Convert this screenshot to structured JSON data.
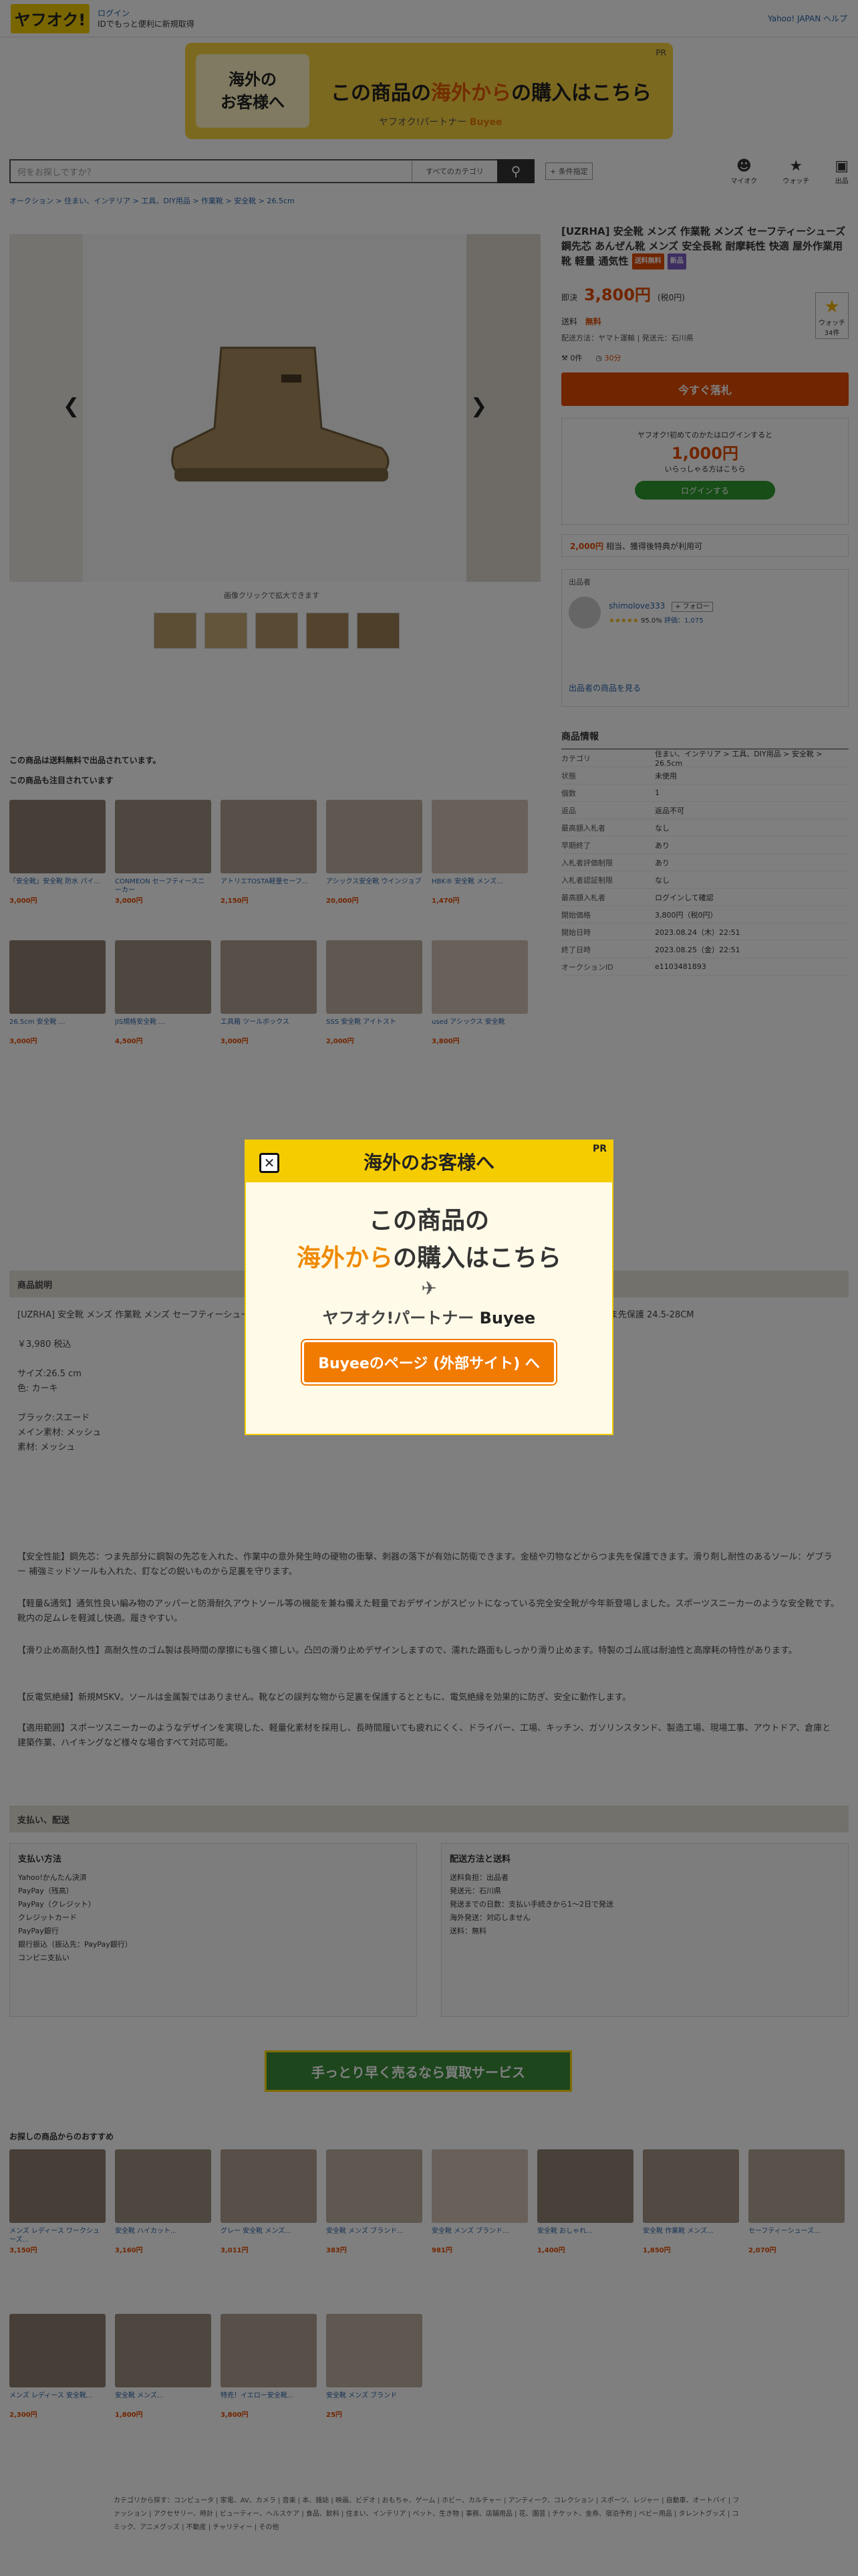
{
  "header": {
    "logo_text": "ヤフオク!",
    "login_label": "ログイン",
    "login_sub": "IDでもっと便利に新規取得",
    "right_link": "Yahoo! JAPAN ヘルプ"
  },
  "top_banner": {
    "left_text": "海外の\nお客様へ",
    "main_pre": "この商品の",
    "main_hl": "海外から",
    "main_post": "の購入はこちら",
    "sub_text": "ヤフオク!パートナー",
    "sub_buyee": "Buyee",
    "pr": "PR"
  },
  "search": {
    "placeholder": "何をお探しですか？",
    "category": "すべてのカテゴリ",
    "button_icon": "search-icon",
    "advanced": "+ 条件指定"
  },
  "head_icons": [
    {
      "icon": "person-icon",
      "label": "マイオク"
    },
    {
      "icon": "star-icon",
      "label": "ウォッチ"
    },
    {
      "icon": "bag-icon",
      "label": "出品"
    }
  ],
  "breadcrumb": "オークション > 住まい、インテリア > 工具、DIY用品 > 作業靴 > 安全靴 > 26.5cm",
  "gallery": {
    "caption": "画像クリックで拡大できます"
  },
  "item": {
    "title": "[UZRHA] 安全靴 メンズ 作業靴 メンズ セーフティーシューズ 鋼先芯 あんぜん靴 メンズ 安全長靴 耐摩耗性 快適 屋外作業用靴 軽量 通気性",
    "badge1": "送料無料",
    "badge2": "新品",
    "price_label": "即決",
    "price": "3,800円",
    "price_tax": "(税0円)",
    "shipping_label": "送料",
    "shipping_value": "無料",
    "ship_detail": "配送方法：ヤマト運輸 | 発送元：石川県",
    "bids": "0件",
    "time_left": "30分",
    "watch_label": "ウォッチ",
    "watch_count": "34件",
    "bid_button": "今すぐ落札"
  },
  "promo": {
    "text1": "ヤフオク!初めてのかたはログインすると",
    "big": "1,000円",
    "text2": "いらっしゃる方はこちら",
    "login_button": "ログインする"
  },
  "points": {
    "value": "2,000円",
    "text": "相当、獲得後特典が利用可"
  },
  "seller": {
    "label": "出品者",
    "name": "shimolove333",
    "follow": "+ フォロー",
    "rating": "95.0%",
    "rating_count": "評価：1,075",
    "more": "出品者の商品を見る"
  },
  "info": {
    "heading": "商品情報",
    "rows": [
      {
        "k": "カテゴリ",
        "v": "住まい、インテリア > 工具、DIY用品 > 安全靴 > 26.5cm"
      },
      {
        "k": "状態",
        "v": "未使用"
      },
      {
        "k": "個数",
        "v": "1"
      },
      {
        "k": "返品",
        "v": "返品不可"
      },
      {
        "k": "最高額入札者",
        "v": "なし"
      },
      {
        "k": "早期終了",
        "v": "あり"
      },
      {
        "k": "入札者評価制限",
        "v": "あり"
      },
      {
        "k": "入札者認証制限",
        "v": "なし"
      },
      {
        "k": "最高額入札者",
        "v": "ログインして確認"
      },
      {
        "k": "開始価格",
        "v": "3,800円（税0円）"
      },
      {
        "k": "開始日時",
        "v": "2023.08.24（木）22:51"
      },
      {
        "k": "終了日時",
        "v": "2023.08.25（金）22:51"
      },
      {
        "k": "オークションID",
        "v": "e1103481893"
      }
    ]
  },
  "shipping_note": "この商品は送料無料で出品されています。",
  "rec1": {
    "title": "この商品も注目されています",
    "items": [
      {
        "name": "「安全靴」安全靴 防水 パイ...",
        "price": "3,000円"
      },
      {
        "name": "CONMEON セーフティースニーカー",
        "price": "3,000円"
      },
      {
        "name": "アトリエTOSTA軽量セーフ...",
        "price": "2,150円"
      },
      {
        "name": "アシックス安全靴 ウインジョブ",
        "price": "20,000円"
      },
      {
        "name": "HBK® 安全靴 メンズ...",
        "price": "1,470円"
      }
    ]
  },
  "rec2": {
    "items": [
      {
        "name": "26.5cm 安全靴 ...",
        "price": "3,000円"
      },
      {
        "name": "JIS規格安全靴 ...",
        "price": "4,500円"
      },
      {
        "name": "工具箱 ツールボックス",
        "price": "3,000円"
      },
      {
        "name": "SSS 安全靴 アイトスト",
        "price": "2,000円"
      },
      {
        "name": "used アシックス 安全靴",
        "price": "3,800円"
      }
    ]
  },
  "desc": {
    "heading": "商品説明",
    "lines": [
      "[UZRHA] 安全靴 メンズ 作業靴 メンズ セーフティーシューズ 鋼先芯 あんぜん靴 メンズ 安全長靴 耐摩耗性 快適 屋外作業用靴 軽量 通気性 滑り止め つま先保護 24.5-28CM",
      "",
      "￥3,980 税込",
      "",
      "サイズ:26.5 cm",
      "色: カーキ",
      "",
      "ブラック:スエード",
      "メイン素材: メッシュ",
      "素材: メッシュ"
    ],
    "para1": "【安全性能】鋼先芯：つま先部分に鋼製の先芯を入れた、作業中の意外発生時の硬物の衝撃、刺器の落下が有効に防衛できます。金槌や刃物などからつま先を保護できます。滑り剤し耐性のあるソール：ゲブラー 補強ミッドソールも入れた、釘などの鋭いものから足裏を守ります。",
    "para2": "【軽量&通気】通気性良い編み物のアッパーと防滑耐久アウトソール等の機能を兼ね備えた軽量でおデザインがスピットになっている完全安全靴が今年新登場しました。スポーツスニーカーのような安全靴です。靴内の足ムレを軽減し快適。履きやすい。",
    "para3": "【滑り止め高耐久性】高耐久性のゴム製は長時間の摩擦にも強く擦しい。凸凹の滑り止めデザインしますので、濡れた路面もしっかり滑り止めます。特製のゴム底は耐油性と高摩耗の特性があります。",
    "para4": "【反電気絶縁】新規MSKV。ソールは金属製ではありません。靴などの誤判な物から足裏を保護するとともに、電気絶縁を効果的に防ぎ、安全に動作します。",
    "para5": "【適用範囲】スポーツスニーカーのようなデザインを実現した、軽量化素材を採用し、長時間履いても疲れにくく、ドライバー、工場、キッチン、ガソリンスタンド、製造工場、現場工事、アウトドア、倉庫と建築作業、ハイキングなど様々な場合すべて対応可能。"
  },
  "payship": {
    "heading": "支払い、配送",
    "pay_title": "支払い方法",
    "pay_items": [
      "Yahoo!かんたん決済",
      "PayPay（残高）",
      "PayPay（クレジット）",
      "クレジットカード",
      "PayPay銀行",
      "銀行振込（振込先：PayPay銀行）",
      "コンビニ支払い"
    ],
    "ship_title": "配送方法と送料",
    "ship_items": [
      "送料負担：出品者",
      "発送元：石川県",
      "発送までの日数：支払い手続きから1〜2日で発送",
      "海外発送：対応しません",
      "送料：無料"
    ]
  },
  "buy_banner": "手っとり早く売るなら買取サービス",
  "rec3": {
    "title": "お探しの商品からのおすすめ",
    "row1": [
      {
        "name": "メンズ レディース ワークシューズ...",
        "price": "3,150円"
      },
      {
        "name": "安全靴 ハイカット...",
        "price": "3,160円"
      },
      {
        "name": "グレー 安全靴 メンズ...",
        "price": "3,011円"
      },
      {
        "name": "安全靴 メンズ ブランド...",
        "price": "383円"
      },
      {
        "name": "安全靴 メンズ ブランド...",
        "price": "981円"
      },
      {
        "name": "安全靴 おしゃれ...",
        "price": "1,400円"
      },
      {
        "name": "安全靴 作業靴 メンズ...",
        "price": "1,850円"
      },
      {
        "name": "セーフティーシューズ...",
        "price": "2,070円"
      }
    ],
    "row2": [
      {
        "name": "メンズ レディース 安全靴...",
        "price": "2,300円"
      },
      {
        "name": "安全靴 メンズ...",
        "price": "1,800円"
      },
      {
        "name": "特売！イエロー安全靴...",
        "price": "3,800円"
      },
      {
        "name": "安全靴 メンズ ブランド",
        "price": "25円"
      }
    ]
  },
  "footer_cats": "カテゴリから探す：コンピュータ | 家電、AV、カメラ | 音楽 | 本、雑誌 | 映画、ビデオ | おもちゃ、ゲーム | ホビー、カルチャー | アンティーク、コレクション | スポーツ、レジャー | 自動車、オートバイ | ファッション | アクセサリー、時計 | ビューティー、ヘルスケア | 食品、飲料 | 住まい、インテリア | ペット、生き物 | 事務、店舗用品 | 花、園芸 | チケット、金券、宿泊予約 | ベビー用品 | タレントグッズ | コミック、アニメグッズ | 不動産 | チャリティー | その他",
  "modal": {
    "title": "海外のお客様へ",
    "pr": "PR",
    "line1": "この商品の",
    "line2_hl": "海外から",
    "line2_post": "の購入はこちら",
    "partner": "ヤフオク!パートナー",
    "buyee": "Buyee",
    "button": "Buyeeのページ (外部サイト) へ",
    "close_icon": "close-icon"
  },
  "colors": {
    "yellow": "#f5cc00",
    "orange": "#e24b00",
    "link": "#2962a8"
  }
}
